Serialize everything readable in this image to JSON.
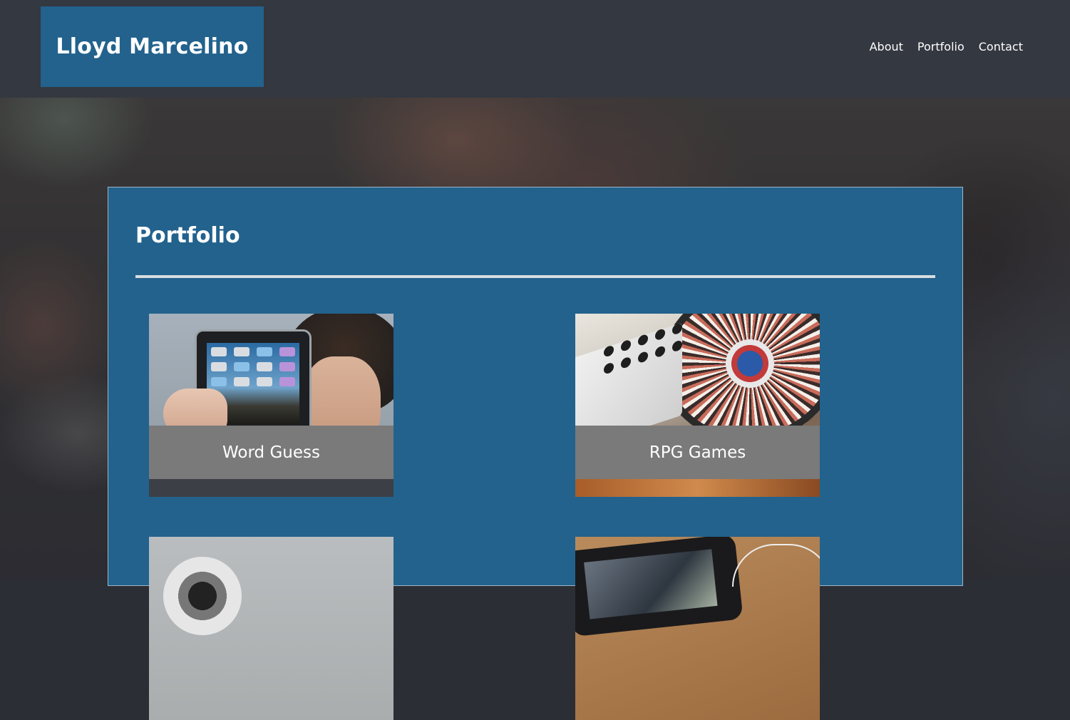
{
  "header": {
    "brand": "Lloyd Marcelino",
    "nav": [
      "About",
      "Portfolio",
      "Contact"
    ]
  },
  "portfolio": {
    "title": "Portfolio",
    "items": [
      {
        "caption": "Word Guess",
        "image": "boy holding tablet"
      },
      {
        "caption": "RPG Games",
        "image": "dj turntable and mixer"
      },
      {
        "caption": "",
        "image": "webcam"
      },
      {
        "caption": "",
        "image": "smartphone with earphones"
      }
    ]
  },
  "colors": {
    "header_bg": "#343840",
    "brand_bg": "#22628d",
    "panel_bg": "#22628d",
    "caption_bg": "#7a7a7a",
    "divider": "#d9dde2"
  }
}
